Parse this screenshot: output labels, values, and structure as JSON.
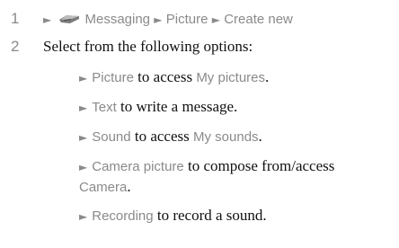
{
  "steps": [
    {
      "number": "1",
      "path": [
        {
          "icon": "messaging-phone-icon",
          "label": "Messaging"
        },
        {
          "label": "Picture"
        },
        {
          "label": "Create new"
        }
      ]
    },
    {
      "number": "2",
      "text": "Select from the following options:",
      "options": [
        {
          "term": "Picture",
          "text": " to access ",
          "target": "My pictures",
          "end": "."
        },
        {
          "term": "Text",
          "text": " to write a message.",
          "target": "",
          "end": ""
        },
        {
          "term": "Sound",
          "text": " to access ",
          "target": "My sounds",
          "end": "."
        },
        {
          "term": "Camera picture",
          "text": " to compose from/access",
          "target": "Camera",
          "end": "."
        },
        {
          "term": "Recording",
          "text": " to record a sound.",
          "target": "",
          "end": ""
        }
      ]
    }
  ],
  "arrow_glyph": "►",
  "colors": {
    "ui_text": "#8a8a8a",
    "body_text": "#111111"
  }
}
